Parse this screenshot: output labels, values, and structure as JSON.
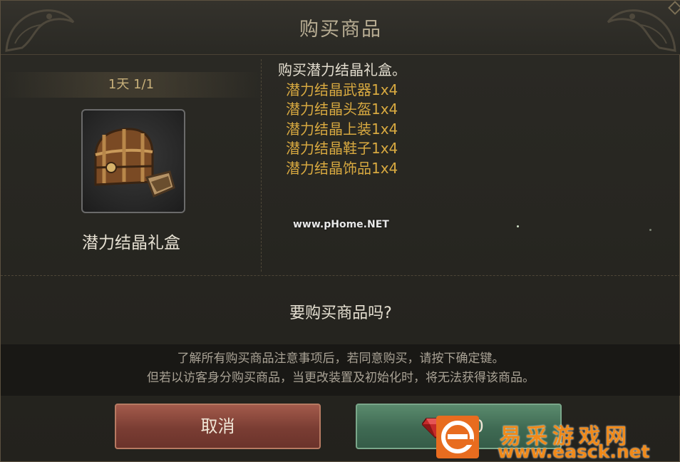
{
  "dialog": {
    "title": "购买商品"
  },
  "item": {
    "limit_text": "1天 1/1",
    "name": "潜力结晶礼盒",
    "icon": "treasure-chest-icon"
  },
  "description": {
    "title": "购买潜力结晶礼盒。",
    "contents": [
      "潜力结晶武器1x4",
      "潜力结晶头盔1x4",
      "潜力结晶上装1x4",
      "潜力结晶鞋子1x4",
      "潜力结晶饰品1x4"
    ]
  },
  "watermark": "www.pHome.NET",
  "prompt": {
    "question": "要购买商品吗?",
    "notice_line1": "了解所有购买商品注意事项后，若同意购买，请按下确定键。",
    "notice_line2": "但若以访客身分购买商品，当更改装置及初始化时，将无法获得该商品。"
  },
  "buttons": {
    "cancel_label": "取消",
    "confirm_price": "400",
    "confirm_icon": "red-gem-icon"
  },
  "site_logo": {
    "name": "易采游戏网",
    "url": "www.easck.net",
    "icon": "e-logo-icon"
  },
  "colors": {
    "accent_gold": "#d8a940",
    "cancel_red": "#7a3d33",
    "confirm_green": "#3f6a53",
    "logo_orange": "#f08a1a"
  }
}
